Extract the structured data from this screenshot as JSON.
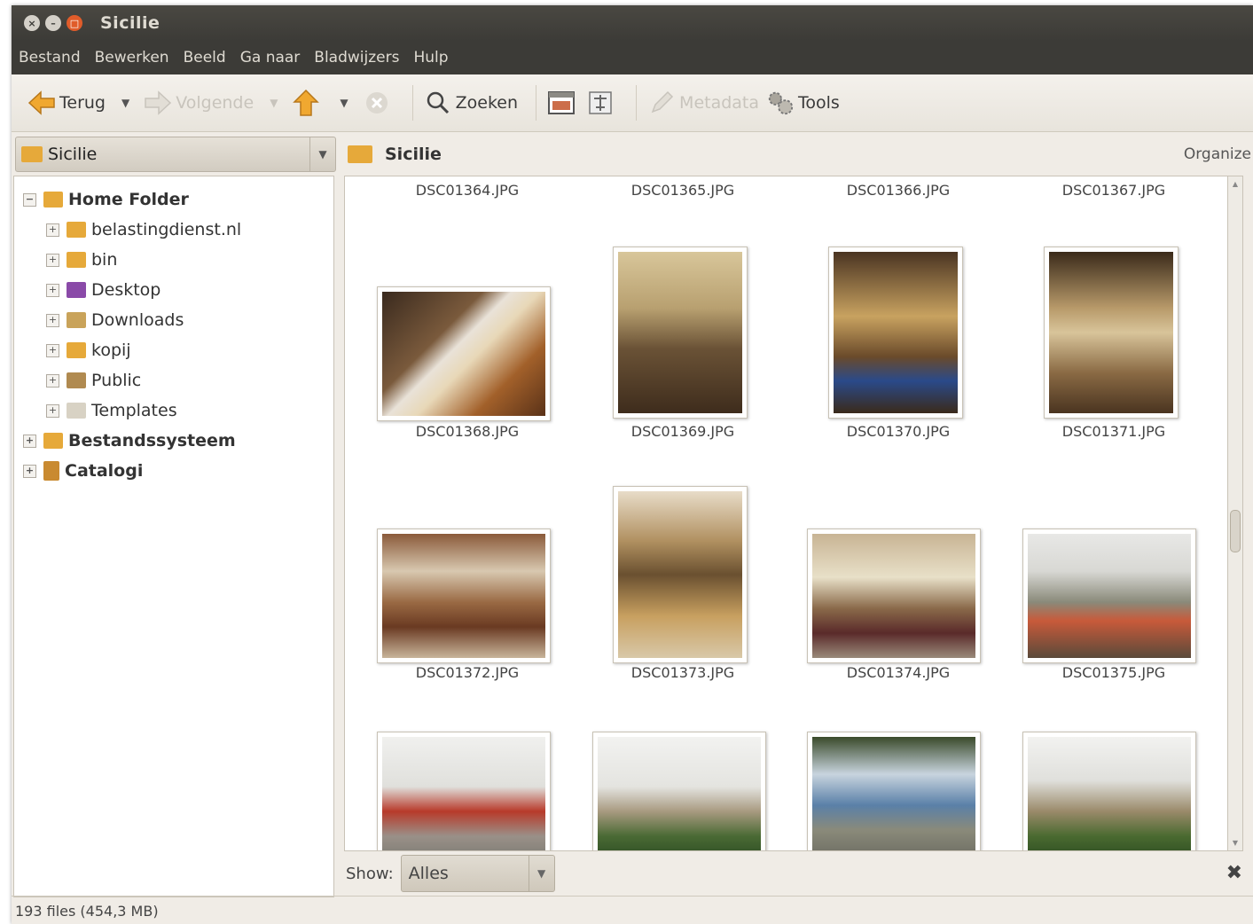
{
  "window": {
    "title": "Sicilie"
  },
  "menu": [
    "Bestand",
    "Bewerken",
    "Beeld",
    "Ga naar",
    "Bladwijzers",
    "Hulp"
  ],
  "toolbar": {
    "back": "Terug",
    "forward": "Volgende",
    "search": "Zoeken",
    "metadata": "Metadata",
    "tools": "Tools"
  },
  "location": {
    "combo": "Sicilie",
    "crumb": "Sicilie",
    "organize": "Organize"
  },
  "tree": [
    {
      "label": "Home Folder",
      "bold": true,
      "expander": "-",
      "indent": 0,
      "icon": "home-folder-icon"
    },
    {
      "label": "belastingdienst.nl",
      "expander": "+",
      "indent": 1,
      "icon": "folder-icon"
    },
    {
      "label": "bin",
      "expander": "+",
      "indent": 1,
      "icon": "folder-icon"
    },
    {
      "label": "Desktop",
      "expander": "+",
      "indent": 1,
      "icon": "desktop-folder-icon"
    },
    {
      "label": "Downloads",
      "expander": "+",
      "indent": 1,
      "icon": "downloads-folder-icon"
    },
    {
      "label": "kopij",
      "expander": "+",
      "indent": 1,
      "icon": "folder-icon"
    },
    {
      "label": "Public",
      "expander": "+",
      "indent": 1,
      "icon": "public-folder-icon"
    },
    {
      "label": "Templates",
      "expander": "+",
      "indent": 1,
      "icon": "templates-folder-icon"
    },
    {
      "label": "Bestandssysteem",
      "bold": true,
      "expander": "+",
      "indent": 0,
      "icon": "filesystem-icon"
    },
    {
      "label": "Catalogi",
      "bold": true,
      "expander": "+",
      "indent": 0,
      "icon": "catalog-icon"
    }
  ],
  "thumbnails": {
    "top_row_captions": [
      "DSC01364.JPG",
      "DSC01365.JPG",
      "DSC01366.JPG",
      "DSC01367.JPG"
    ],
    "rows": [
      [
        "DSC01368.JPG",
        "DSC01369.JPG",
        "DSC01370.JPG",
        "DSC01371.JPG"
      ],
      [
        "DSC01372.JPG",
        "DSC01373.JPG",
        "DSC01374.JPG",
        "DSC01375.JPG"
      ]
    ]
  },
  "filter": {
    "label": "Show:",
    "value": "Alles"
  },
  "status": "193 files (454,3 MB)",
  "colors": {
    "titlebar": "#3c3b37",
    "close_button": "#e05c2a",
    "folder": "#e6a93a"
  }
}
